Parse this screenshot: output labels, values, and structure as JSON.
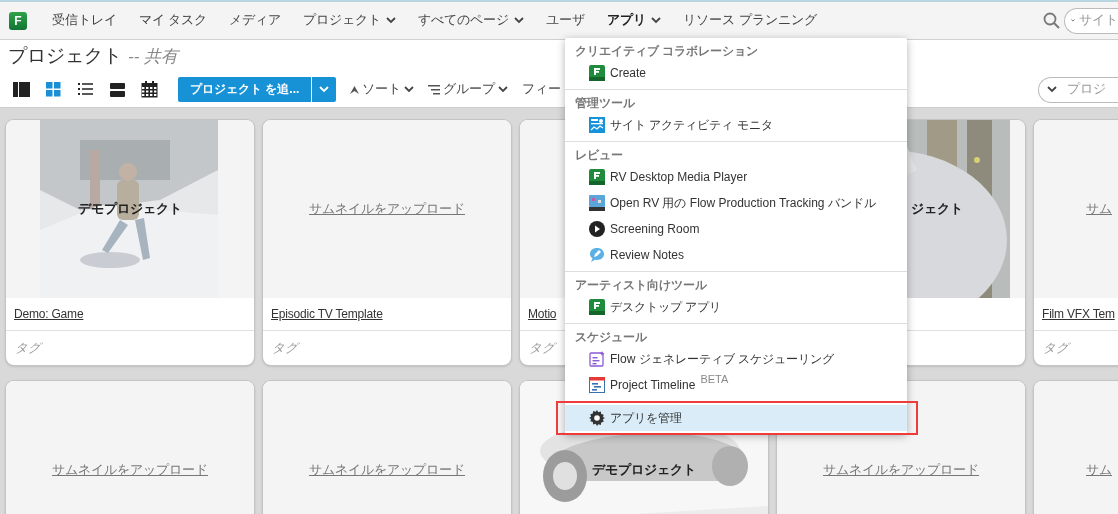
{
  "nav": {
    "logo_letter": "F",
    "items": [
      {
        "label": "受信トレイ",
        "dropdown": false,
        "selected": false
      },
      {
        "label": "マイ タスク",
        "dropdown": false,
        "selected": false
      },
      {
        "label": "メディア",
        "dropdown": false,
        "selected": false
      },
      {
        "label": "プロジェクト",
        "dropdown": true,
        "selected": false
      },
      {
        "label": "すべてのページ",
        "dropdown": true,
        "selected": false
      },
      {
        "label": "ユーザ",
        "dropdown": false,
        "selected": false
      },
      {
        "label": "アプリ",
        "dropdown": true,
        "selected": true
      },
      {
        "label": "リソース プランニング",
        "dropdown": false,
        "selected": false
      }
    ],
    "search": {
      "placeholder": "サイト"
    }
  },
  "page": {
    "title": "プロジェクト",
    "subtitle": "-- 共有"
  },
  "toolbar": {
    "views": [
      {
        "kind": "panel",
        "selected": false
      },
      {
        "kind": "grid",
        "selected": true
      },
      {
        "kind": "list",
        "selected": false
      },
      {
        "kind": "rows",
        "selected": false
      },
      {
        "kind": "calendar",
        "selected": false
      }
    ],
    "add_button": "プロジェクト を追...",
    "controls": [
      {
        "kind": "sort",
        "label": "ソート"
      },
      {
        "kind": "group",
        "label": "グループ"
      },
      {
        "kind": "filter",
        "label": "フィー"
      }
    ],
    "filter_field": {
      "placeholder": "プロジ"
    }
  },
  "cards": [
    [
      {
        "title": "Demo: Game",
        "tag": "タグ",
        "thumb": {
          "kind": "picture",
          "overlay": "デモプロジェクト"
        }
      },
      {
        "title": "Episodic TV Template",
        "tag": "タグ",
        "thumb": {
          "kind": "upload",
          "link": "サムネイルをアップロード"
        }
      },
      {
        "title": "Motio",
        "tag": "タグ",
        "thumb": {
          "kind": "blank"
        }
      },
      {
        "thumb": {
          "kind": "covered_picture",
          "overlay": "ジェクト"
        }
      },
      {
        "title": "Film VFX Tem",
        "tag": "タグ",
        "thumb": {
          "kind": "cut_upload",
          "link": "サム"
        }
      }
    ],
    [
      {
        "thumb": {
          "kind": "upload",
          "link": "サムネイルをアップロード"
        }
      },
      {
        "thumb": {
          "kind": "upload",
          "link": "サムネイルをアップロード"
        }
      },
      {
        "thumb": {
          "kind": "picture",
          "overlay": "デモプロジェクト"
        }
      },
      {
        "thumb": {
          "kind": "upload",
          "link": "サムネイルをアップロード"
        }
      },
      {
        "thumb": {
          "kind": "cut_upload",
          "link": "サム"
        }
      }
    ]
  ],
  "apps_menu": {
    "sections": [
      {
        "heading": "クリエイティブ コラボレーション",
        "items": [
          {
            "label": "Create",
            "kind": "fpt"
          }
        ]
      },
      {
        "heading": "管理ツール",
        "items": [
          {
            "label": "サイト アクティビティ モニタ",
            "kind": "monitor"
          }
        ]
      },
      {
        "heading": "レビュー",
        "items": [
          {
            "label": "RV Desktop Media Player",
            "kind": "fpt"
          },
          {
            "label": "Open RV 用の Flow Production Tracking バンドル",
            "kind": "bundle"
          },
          {
            "label": "Screening Room",
            "kind": "play"
          },
          {
            "label": "Review Notes",
            "kind": "notes"
          }
        ]
      },
      {
        "heading": "アーティスト向けツール",
        "items": [
          {
            "label": "デスクトップ アプリ",
            "kind": "fpt"
          }
        ]
      },
      {
        "heading": "スケジュール",
        "items": [
          {
            "label": "Flow ジェネレーティブ スケジューリング",
            "kind": "schedule"
          },
          {
            "label": "Project Timeline",
            "kind": "timeline",
            "badge": "BETA"
          }
        ]
      }
    ],
    "footer": {
      "label": "アプリを管理",
      "kind": "gear",
      "selected": true,
      "highlighted": true
    }
  }
}
